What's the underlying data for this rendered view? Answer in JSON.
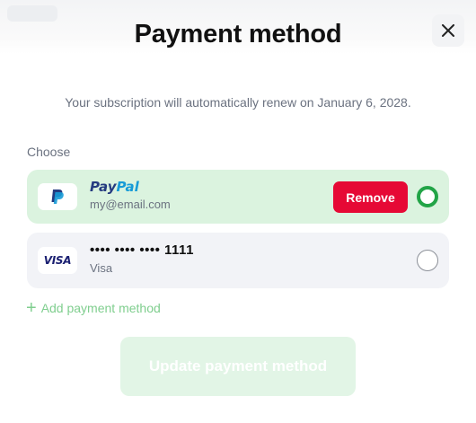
{
  "dialog": {
    "title": "Payment method",
    "subtitle": "Your subscription will automatically renew on January 6, 2028.",
    "choose_label": "Choose",
    "close_icon": "close-icon"
  },
  "methods": [
    {
      "brand": "PayPal",
      "brand_part_1": "Pay",
      "brand_part_2": "Pal",
      "detail": "my@email.com",
      "selected": true,
      "remove_label": "Remove",
      "icon": "paypal-icon"
    },
    {
      "brand": "VISA",
      "number": "•••• •••• •••• 1111",
      "detail": "Visa",
      "selected": false,
      "icon": "visa-icon"
    }
  ],
  "add_method_label": "Add payment method",
  "update_button_label": "Update payment method",
  "colors": {
    "accent_green": "#22a447",
    "selected_bg": "#dbf3df",
    "remove_red": "#e60935",
    "paypal_dark": "#253b80",
    "paypal_light": "#179bd7",
    "visa_blue": "#1a1f71"
  }
}
